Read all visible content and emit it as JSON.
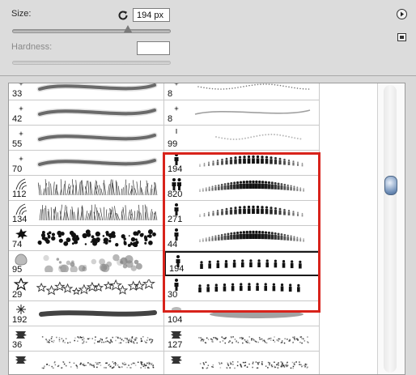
{
  "size": {
    "label": "Size:",
    "value": "194 px",
    "slider_fraction": 0.73
  },
  "hardness": {
    "label": "Hardness:",
    "value": ""
  },
  "icons": {
    "reset": "reset-cycle-icon",
    "menu": "panel-menu-arrow-icon",
    "new": "new-preset-icon"
  },
  "colors": {
    "highlight": "#d8231b",
    "accent": "#6f8fb8"
  },
  "brushes_left": [
    {
      "size": "33",
      "tip": "dot",
      "stroke": "soft-wave"
    },
    {
      "size": "42",
      "tip": "dot",
      "stroke": "soft-wave"
    },
    {
      "size": "55",
      "tip": "dot",
      "stroke": "soft-wave"
    },
    {
      "size": "70",
      "tip": "dot",
      "stroke": "soft-wave"
    },
    {
      "size": "112",
      "tip": "grass",
      "stroke": "grass"
    },
    {
      "size": "134",
      "tip": "grass",
      "stroke": "grass"
    },
    {
      "size": "74",
      "tip": "splat",
      "stroke": "splatter"
    },
    {
      "size": "95",
      "tip": "blob",
      "stroke": "dots"
    },
    {
      "size": "29",
      "tip": "star",
      "stroke": "stars"
    },
    {
      "size": "192",
      "tip": "spark",
      "stroke": "dark-streak"
    },
    {
      "size": "36",
      "tip": "texture",
      "stroke": "textured"
    },
    {
      "size": "",
      "tip": "texture",
      "stroke": "textured"
    }
  ],
  "brushes_right": [
    {
      "size": "8",
      "tip": "dot",
      "stroke": "dotted"
    },
    {
      "size": "8",
      "tip": "dot",
      "stroke": "thin-wave"
    },
    {
      "size": "99",
      "tip": "tick",
      "stroke": "faint"
    },
    {
      "size": "194",
      "tip": "person",
      "stroke": "people-small"
    },
    {
      "size": "820",
      "tip": "people",
      "stroke": "people-crowd"
    },
    {
      "size": "271",
      "tip": "person",
      "stroke": "people-small"
    },
    {
      "size": "44",
      "tip": "person",
      "stroke": "people-crowd"
    },
    {
      "size": "194",
      "tip": "person",
      "stroke": "people-large"
    },
    {
      "size": "30",
      "tip": "person",
      "stroke": "people-large"
    },
    {
      "size": "104",
      "tip": "blur",
      "stroke": "blur-streak"
    },
    {
      "size": "127",
      "tip": "texture",
      "stroke": "textured"
    },
    {
      "size": "",
      "tip": "texture",
      "stroke": "textured"
    }
  ],
  "selected_right_index": 7
}
